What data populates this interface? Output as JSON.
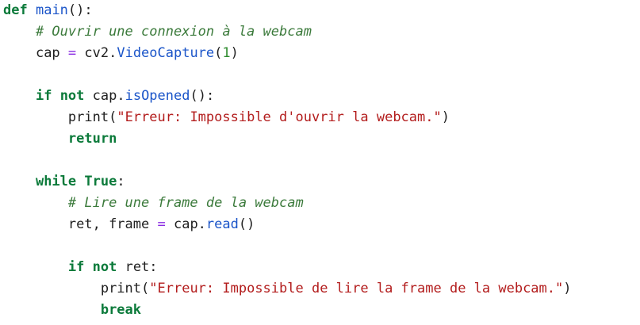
{
  "kw": {
    "def": "def",
    "if": "if",
    "not": "not",
    "return": "return",
    "while": "while",
    "true": "True",
    "break": "break"
  },
  "line1": {
    "name": "main",
    "rest": "():"
  },
  "line2": {
    "comment": "# Ouvrir une connexion à la webcam"
  },
  "line3": {
    "lhs": "cap ",
    "op": "=",
    "mid": " cv2.",
    "fn": "VideoCapture",
    "paren_open": "(",
    "num": "1",
    "paren_close": ")"
  },
  "line5": {
    "sp": " ",
    "obj": " cap.",
    "fn": "isOpened",
    "rest": "():"
  },
  "line6": {
    "fn": "print",
    "open": "(",
    "str": "\"Erreur: Impossible d'ouvrir la webcam.\"",
    "close": ")"
  },
  "line9": {
    "colon": ":"
  },
  "line10": {
    "comment": "# Lire une frame de la webcam"
  },
  "line11": {
    "lhs": "ret, frame ",
    "op": "=",
    "mid": " cap.",
    "fn": "read",
    "rest": "()"
  },
  "line13": {
    "rest": " ret:"
  },
  "line14": {
    "fn": "print",
    "open": "(",
    "str": "\"Erreur: Impossible de lire la frame de la webcam.\"",
    "close": ")"
  }
}
